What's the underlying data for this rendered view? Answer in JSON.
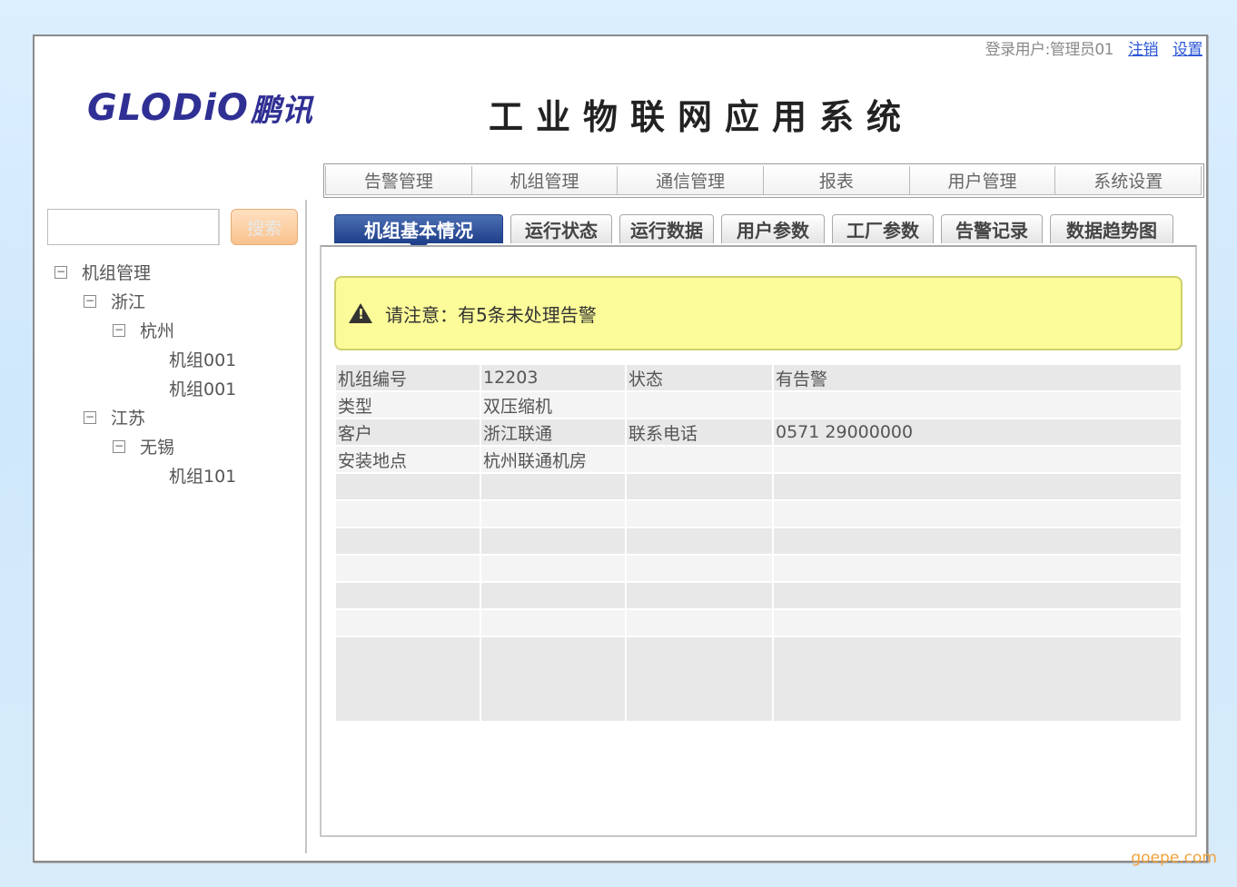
{
  "header": {
    "login_label": "登录用户:管理员01",
    "logout_link": "注销",
    "settings_link": "设置",
    "logo_en": "GLODiO",
    "logo_cn": "鹏讯",
    "app_title": "工业物联网应用系统"
  },
  "main_nav": [
    "告警管理",
    "机组管理",
    "通信管理",
    "报表",
    "用户管理",
    "系统设置"
  ],
  "search": {
    "placeholder": "",
    "button": "搜索"
  },
  "tree": {
    "root": "机组管理",
    "p1": "浙江",
    "c1": "杭州",
    "u1": "机组001",
    "u2": "机组001",
    "p2": "江苏",
    "c2": "无锡",
    "u3": "机组101",
    "toggle": "−"
  },
  "tabs": [
    "机组基本情况",
    "运行状态",
    "运行数据",
    "用户参数",
    "工厂参数",
    "告警记录",
    "数据趋势图"
  ],
  "alert": {
    "message": "请注意：有5条未处理告警"
  },
  "table": {
    "rows": [
      [
        "机组编号",
        "12203",
        "状态",
        "有告警"
      ],
      [
        "类型",
        "双压缩机",
        "",
        ""
      ],
      [
        "客户",
        "浙江联通",
        "联系电话",
        "0571 29000000"
      ],
      [
        "安装地点",
        "杭州联通机房",
        "",
        ""
      ]
    ]
  },
  "watermark": "goepe.com",
  "colors": {
    "accent": "#1f3f8a",
    "alert_bg": "#fbfb99",
    "search_button": "#f9c28d",
    "link": "#2b57d6"
  }
}
